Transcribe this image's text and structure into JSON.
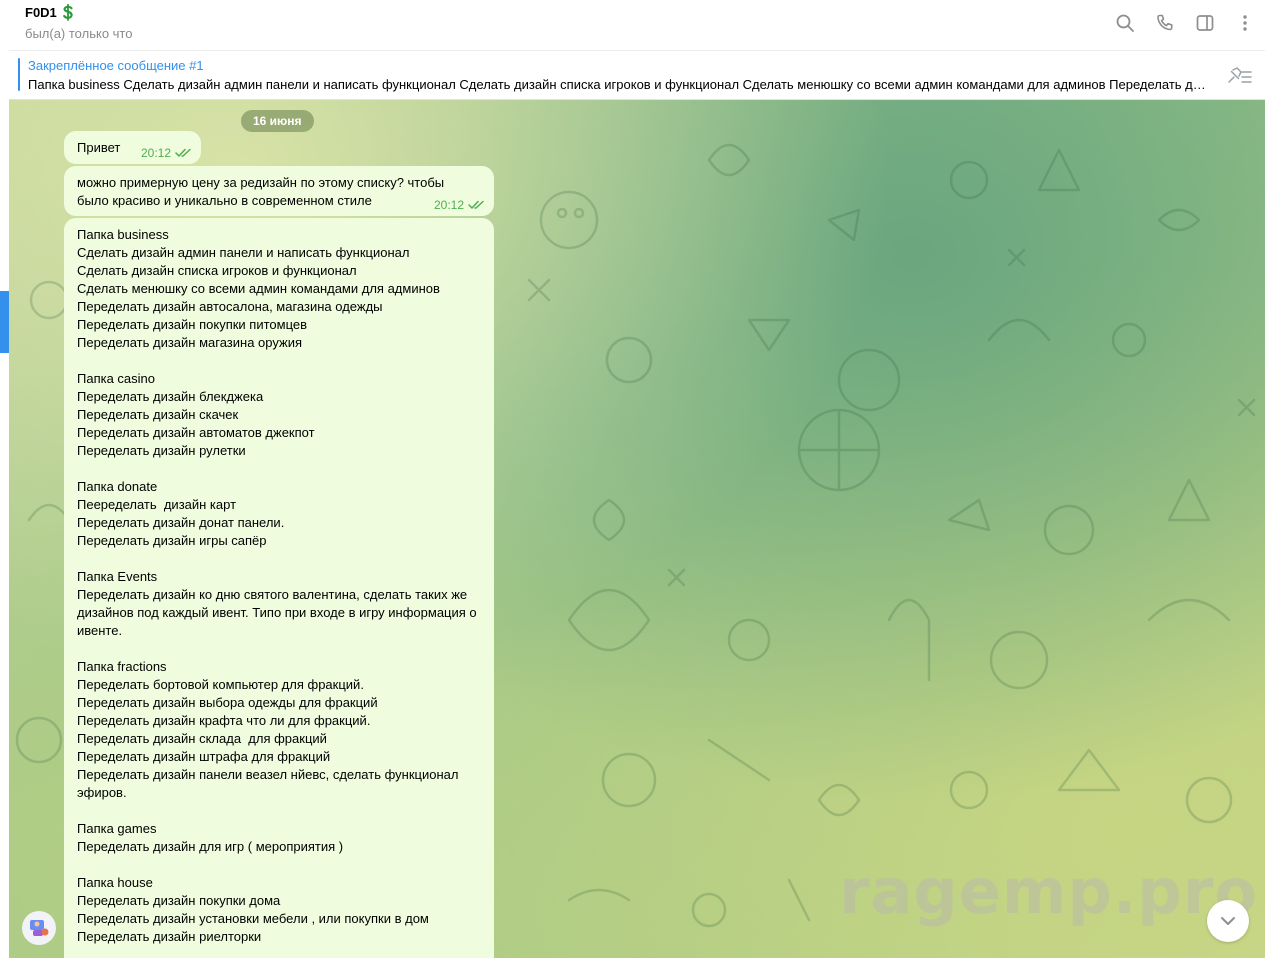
{
  "header": {
    "contact_name": "F0D1",
    "status": "был(а) только что",
    "icons": [
      "search-icon",
      "phone-icon",
      "sidebar-toggle-icon",
      "more-vertical-icon"
    ]
  },
  "pinned": {
    "title": "Закреплённое сообщение #1",
    "preview": "Папка business  Сделать дизайн админ панели и написать функционал Сделать дизайн списка игроков и функционал Сделать менюшку со всеми админ командами для админов  Переделать дизайн автосалона, магазина одежды"
  },
  "chat": {
    "date": "16 июня",
    "messages": [
      {
        "text": "Привет",
        "time": "20:12",
        "read": true
      },
      {
        "text": "можно примерную цену за редизайн по этому списку? чтобы было красиво и уникально в современном стиле",
        "time": "20:12",
        "read": true
      },
      {
        "text": "Папка business\nСделать дизайн админ панели и написать функционал\nСделать дизайн списка игроков и функционал\nСделать менюшку со всеми админ командами для админов\nПеределать дизайн автосалона, магазина одежды\nПеределать дизайн покупки питомцев\nПеределать дизайн магазина оружия\n\nПапка casino\nПеределать дизайн блекджека\nПеределать дизайн скачек\nПеределать дизайн автоматов джекпот\nПеределать дизайн рулетки\n\nПапка donate\nПееределать  дизайн карт\nПеределать дизайн донат панели.\nПеределать дизайн игры сапёр\n\nПапка Events\nПеределать дизайн ко дню святого валентина, сделать таких же дизайнов под каждый ивент. Типо при входе в игру информация о ивенте.\n\nПапка fractions\nПеределать бортовой компьютер для фракций.\nПеределать дизайн выбора одежды для фракций\nПеределать дизайн крафта что ли для фракций.\nПеределать дизайн склада  для фракций\nПеределать дизайн штрафа для фракций\nПеределать дизайн панели веазел нйевс, сделать функционал эфиров.\n\nПапка games\nПеределать дизайн для игр ( мероприятия )\n\nПапка house\nПеределать дизайн покупки дома\nПеределать дизайн установки мебели , или покупки в дом\nПеределать дизайн риелторки"
      }
    ]
  },
  "watermark": "ragemp.pro",
  "colors": {
    "accent": "#3390ec",
    "bubble": "#effdde",
    "time_green": "#4fae4e"
  }
}
